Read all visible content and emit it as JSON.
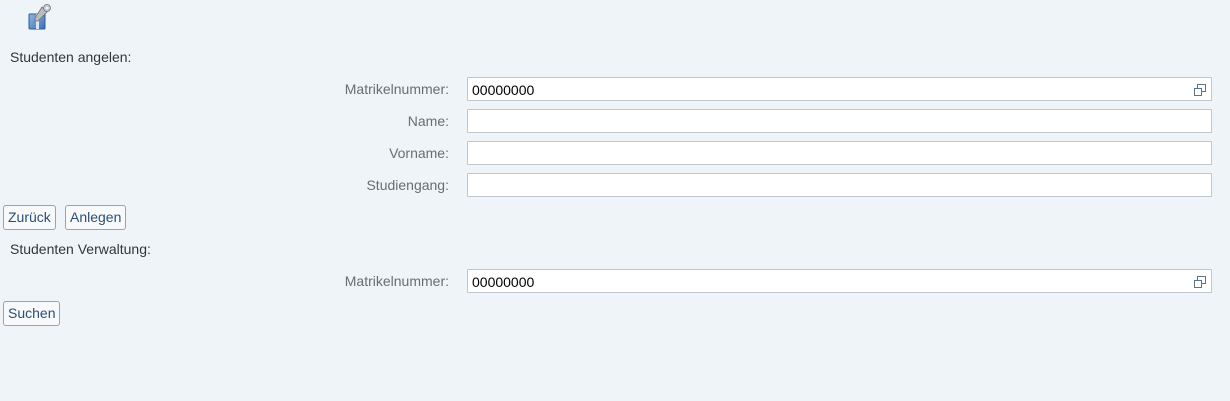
{
  "icons": {
    "app_icon": "tools-icon",
    "value_help_icon": "value-help-icon"
  },
  "colors": {
    "background": "#eff4f9",
    "button_text": "#2c4f74",
    "label_text": "#6a6d70"
  },
  "create_section": {
    "title": "Studenten angelen:",
    "fields": {
      "matrikelnummer": {
        "label": "Matrikelnummer:",
        "value": "00000000"
      },
      "name": {
        "label": "Name:",
        "value": ""
      },
      "vorname": {
        "label": "Vorname:",
        "value": ""
      },
      "studiengang": {
        "label": "Studiengang:",
        "value": ""
      }
    },
    "buttons": {
      "back": "Zurück",
      "create": "Anlegen"
    }
  },
  "manage_section": {
    "title": "Studenten Verwaltung:",
    "fields": {
      "matrikelnummer": {
        "label": "Matrikelnummer:",
        "value": "00000000"
      }
    },
    "buttons": {
      "search": "Suchen"
    }
  }
}
